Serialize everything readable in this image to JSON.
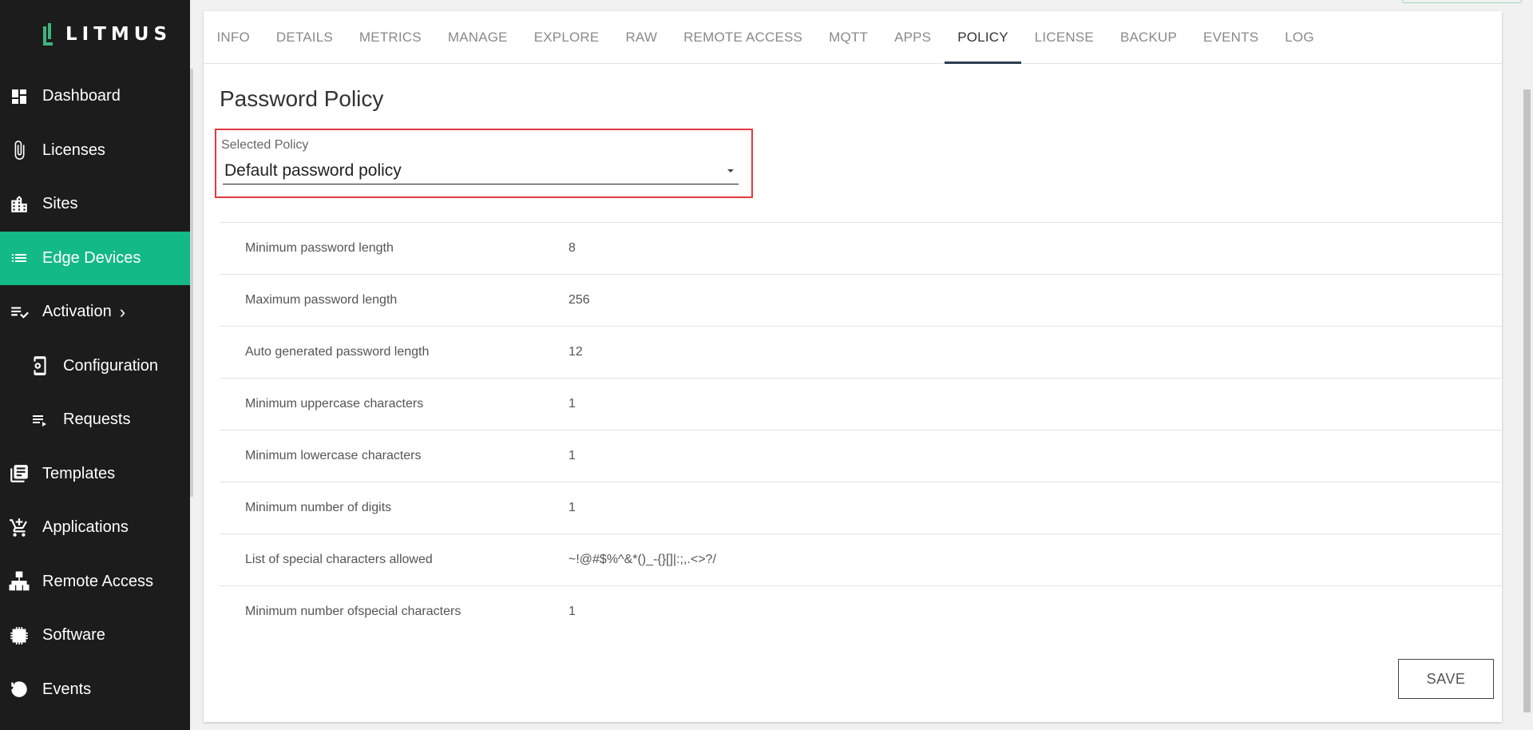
{
  "brand": {
    "logo_text": "LITMUS",
    "accent": "#13b986"
  },
  "sidebar": {
    "items": [
      {
        "label": "Dashboard",
        "icon": "dashboard-icon"
      },
      {
        "label": "Licenses",
        "icon": "paperclip-icon"
      },
      {
        "label": "Sites",
        "icon": "building-icon"
      },
      {
        "label": "Edge Devices",
        "icon": "list-icon",
        "active": true
      },
      {
        "label": "Activation",
        "icon": "checklist-icon",
        "chevron": "›"
      },
      {
        "label": "Configuration",
        "icon": "device-settings-icon",
        "sub": true
      },
      {
        "label": "Requests",
        "icon": "playlist-icon",
        "sub": true
      },
      {
        "label": "Templates",
        "icon": "library-icon"
      },
      {
        "label": "Applications",
        "icon": "cart-add-icon"
      },
      {
        "label": "Remote Access",
        "icon": "network-icon"
      },
      {
        "label": "Software",
        "icon": "chip-icon"
      },
      {
        "label": "Events",
        "icon": "history-icon"
      }
    ]
  },
  "tabs": [
    "INFO",
    "DETAILS",
    "METRICS",
    "MANAGE",
    "EXPLORE",
    "RAW",
    "REMOTE ACCESS",
    "MQTT",
    "APPS",
    "POLICY",
    "LICENSE",
    "BACKUP",
    "EVENTS",
    "LOG"
  ],
  "active_tab": "POLICY",
  "main": {
    "title": "Password Policy",
    "select": {
      "label": "Selected Policy",
      "value": "Default password policy"
    },
    "rules": [
      {
        "label": "Minimum password length",
        "value": "8"
      },
      {
        "label": "Maximum password length",
        "value": "256"
      },
      {
        "label": "Auto generated password length",
        "value": "12"
      },
      {
        "label": "Minimum uppercase characters",
        "value": "1"
      },
      {
        "label": "Minimum lowercase characters",
        "value": "1"
      },
      {
        "label": "Minimum number of digits",
        "value": "1"
      },
      {
        "label": "List of special characters allowed",
        "value": "~!@#$%^&*()_-{}[]|:;,.<>?/"
      },
      {
        "label": "Minimum number ofspecial characters",
        "value": "1"
      }
    ],
    "save_label": "SAVE"
  }
}
